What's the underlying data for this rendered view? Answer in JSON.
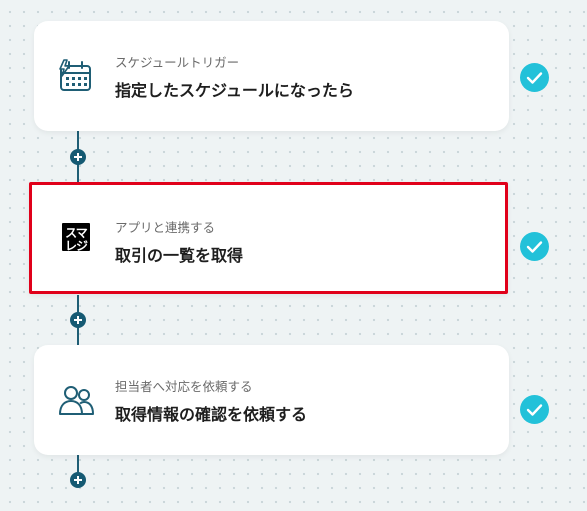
{
  "flow": {
    "steps": [
      {
        "subtitle": "スケジュールトリガー",
        "title": "指定したスケジュールになったら",
        "icon": "calendar-lightning-icon",
        "status": "completed"
      },
      {
        "subtitle": "アプリと連携する",
        "title": "取引の一覧を取得",
        "icon": "smaregi-logo",
        "logo_line1": "スマ",
        "logo_line2": "レジ",
        "status": "completed",
        "selected": true
      },
      {
        "subtitle": "担当者へ対応を依頼する",
        "title": "取得情報の確認を依頼する",
        "icon": "users-icon",
        "status": "completed"
      }
    ]
  },
  "colors": {
    "background": "#eef3f4",
    "connector": "#1f5e75",
    "check": "#22c1d9",
    "selection_border": "#e0001a"
  }
}
